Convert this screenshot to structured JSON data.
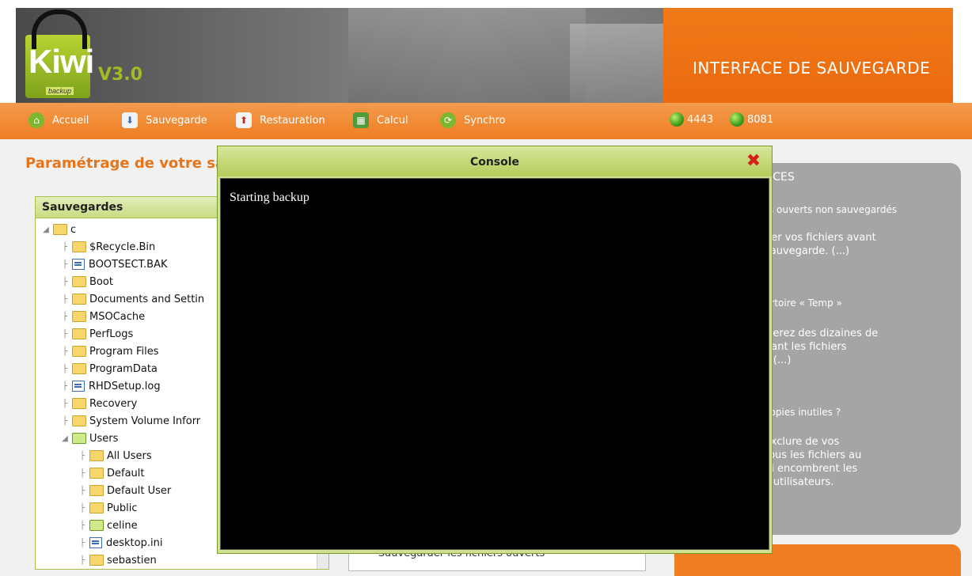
{
  "header": {
    "logo_text": "Kiwi",
    "logo_sub": "backup",
    "version": "V3.0",
    "title": "INTERFACE DE SAUVEGARDE"
  },
  "nav": {
    "items": [
      {
        "label": "Accueil",
        "icon": "home-icon"
      },
      {
        "label": "Sauvegarde",
        "icon": "backup-icon"
      },
      {
        "label": "Restauration",
        "icon": "restore-icon"
      },
      {
        "label": "Calcul",
        "icon": "calculator-icon"
      },
      {
        "label": "Synchro",
        "icon": "sync-icon"
      }
    ],
    "status": [
      {
        "label": "4443",
        "color": "#3f9a1b"
      },
      {
        "label": "8081",
        "color": "#3f9a1b"
      }
    ]
  },
  "page": {
    "title": "Paramétrage de votre sa"
  },
  "tree": {
    "header": "Sauvegardes",
    "rows": [
      {
        "label": "c",
        "type": "folder"
      },
      {
        "label": "$Recycle.Bin",
        "type": "folder"
      },
      {
        "label": "BOOTSECT.BAK",
        "type": "file"
      },
      {
        "label": "Boot",
        "type": "folder"
      },
      {
        "label": "Documents and Settin",
        "type": "folder"
      },
      {
        "label": "MSOCache",
        "type": "folder"
      },
      {
        "label": "PerfLogs",
        "type": "folder"
      },
      {
        "label": "Program Files",
        "type": "folder"
      },
      {
        "label": "ProgramData",
        "type": "folder"
      },
      {
        "label": "RHDSetup.log",
        "type": "file"
      },
      {
        "label": "Recovery",
        "type": "folder"
      },
      {
        "label": "System Volume Inforr",
        "type": "folder"
      },
      {
        "label": "Users",
        "type": "folder-open"
      },
      {
        "label": "All Users",
        "type": "folder"
      },
      {
        "label": "Default",
        "type": "folder"
      },
      {
        "label": "Default User",
        "type": "folder"
      },
      {
        "label": "Public",
        "type": "folder"
      },
      {
        "label": "celine",
        "type": "folder-open"
      },
      {
        "label": "desktop.ini",
        "type": "file"
      },
      {
        "label": "sebastien",
        "type": "folder"
      }
    ]
  },
  "options": {
    "text": "Sauvegarder les fichiers ouverts"
  },
  "tips": {
    "title": "UCES",
    "items": [
      {
        "heading": "rs ouverts non sauvegardés",
        "body": [
          "ner vos fichiers avant",
          "sauvegarde. (...)"
        ]
      },
      {
        "heading": "ertoire « Temp »",
        "body": [
          "iserez des dizaines de",
          "uant les fichiers",
          "s (...)"
        ]
      },
      {
        "heading": "copies inutiles ?",
        "body": [
          "exclure de vos",
          "tous les fichiers au",
          "ui encombrent les",
          "s utilisateurs."
        ]
      }
    ]
  },
  "console": {
    "title": "Console",
    "output": "Starting backup"
  }
}
